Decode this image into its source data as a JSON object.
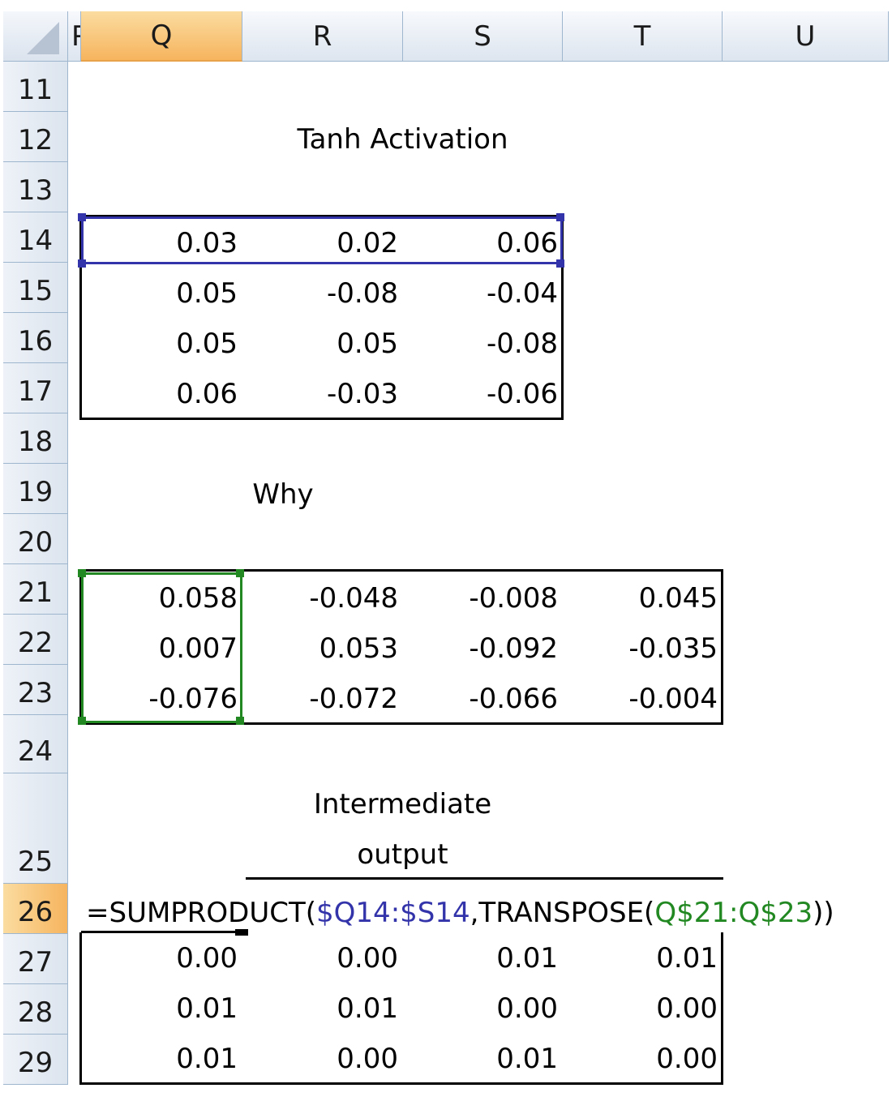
{
  "columns": [
    "P",
    "Q",
    "R",
    "S",
    "T",
    "U"
  ],
  "selected_column": "Q",
  "rows": [
    "11",
    "12",
    "13",
    "14",
    "15",
    "16",
    "17",
    "18",
    "19",
    "20",
    "21",
    "22",
    "23",
    "24",
    "25",
    "26",
    "27",
    "28",
    "29"
  ],
  "selected_row": "26",
  "tanh": {
    "title": "Tanh Activation",
    "values": [
      [
        "0.03",
        "0.02",
        "0.06"
      ],
      [
        "0.05",
        "-0.08",
        "-0.04"
      ],
      [
        "0.05",
        "0.05",
        "-0.08"
      ],
      [
        "0.06",
        "-0.03",
        "-0.06"
      ]
    ]
  },
  "why": {
    "title": "Why",
    "values": [
      [
        "0.058",
        "-0.048",
        "-0.008",
        "0.045"
      ],
      [
        "0.007",
        "0.053",
        "-0.092",
        "-0.035"
      ],
      [
        "-0.076",
        "-0.072",
        "-0.066",
        "-0.004"
      ]
    ]
  },
  "intermediate": {
    "title_line1": "Intermediate",
    "title_line2": "output",
    "values": [
      [
        "0.00",
        "0.00",
        "0.01",
        "0.01"
      ],
      [
        "0.01",
        "0.01",
        "0.00",
        "0.00"
      ],
      [
        "0.01",
        "0.00",
        "0.01",
        "0.00"
      ]
    ]
  },
  "formula": {
    "prefix": "=SUMPRODUCT(",
    "ref1": "$Q14:$S14",
    "middle": ",TRANSPOSE(",
    "ref2": "Q$21:Q$23",
    "suffix": "))"
  },
  "colors": {
    "selection_blue": "#3333aa",
    "selection_green": "#228822",
    "header_selected": "#f6b45e",
    "header_bg": "#dde5ef"
  }
}
